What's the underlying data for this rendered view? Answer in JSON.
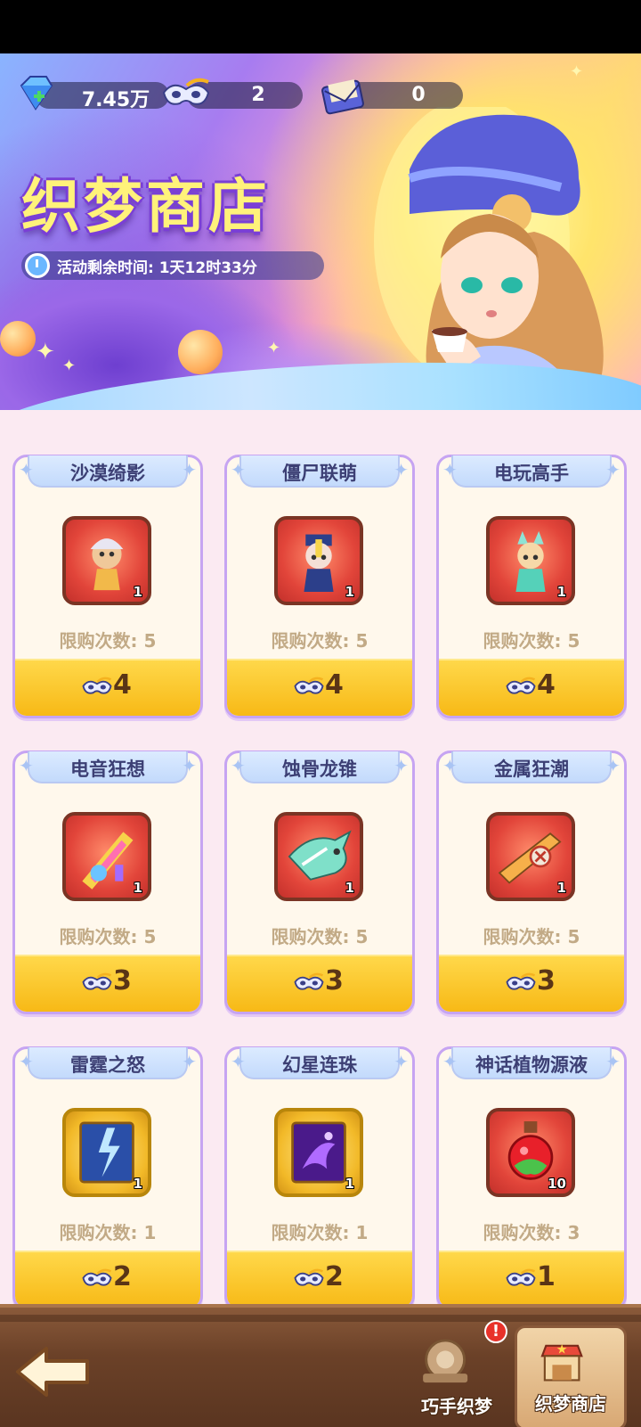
{
  "header": {
    "currencies": {
      "diamonds": "7.45万",
      "masks": "2",
      "tickets": "0"
    },
    "title": "织梦商店",
    "timer_label": "活动剩余时间: 1天12时33分"
  },
  "shop": {
    "items": [
      {
        "name": "沙漠绮影",
        "qty": "1",
        "limit": "限购次数: 5",
        "price": "4",
        "frame": "red"
      },
      {
        "name": "僵尸联萌",
        "qty": "1",
        "limit": "限购次数: 5",
        "price": "4",
        "frame": "red"
      },
      {
        "name": "电玩高手",
        "qty": "1",
        "limit": "限购次数: 5",
        "price": "4",
        "frame": "red"
      },
      {
        "name": "电音狂想",
        "qty": "1",
        "limit": "限购次数: 5",
        "price": "3",
        "frame": "red"
      },
      {
        "name": "蚀骨龙锥",
        "qty": "1",
        "limit": "限购次数: 5",
        "price": "3",
        "frame": "red"
      },
      {
        "name": "金属狂潮",
        "qty": "1",
        "limit": "限购次数: 5",
        "price": "3",
        "frame": "red"
      },
      {
        "name": "雷霆之怒",
        "qty": "1",
        "limit": "限购次数: 1",
        "price": "2",
        "frame": "gold"
      },
      {
        "name": "幻星连珠",
        "qty": "1",
        "limit": "限购次数: 1",
        "price": "2",
        "frame": "gold"
      },
      {
        "name": "神话植物源液",
        "qty": "10",
        "limit": "限购次数: 3",
        "price": "1",
        "frame": "red"
      }
    ]
  },
  "nav": {
    "tab1": {
      "label": "巧手织梦",
      "badge": "!"
    },
    "tab2": {
      "label": "织梦商店"
    }
  },
  "colors": {
    "background": "#fbeaf2",
    "card_border": "#c6a4f2",
    "price_bar": "#f7b916",
    "title": "#fff27a",
    "badge": "#e8322a"
  }
}
